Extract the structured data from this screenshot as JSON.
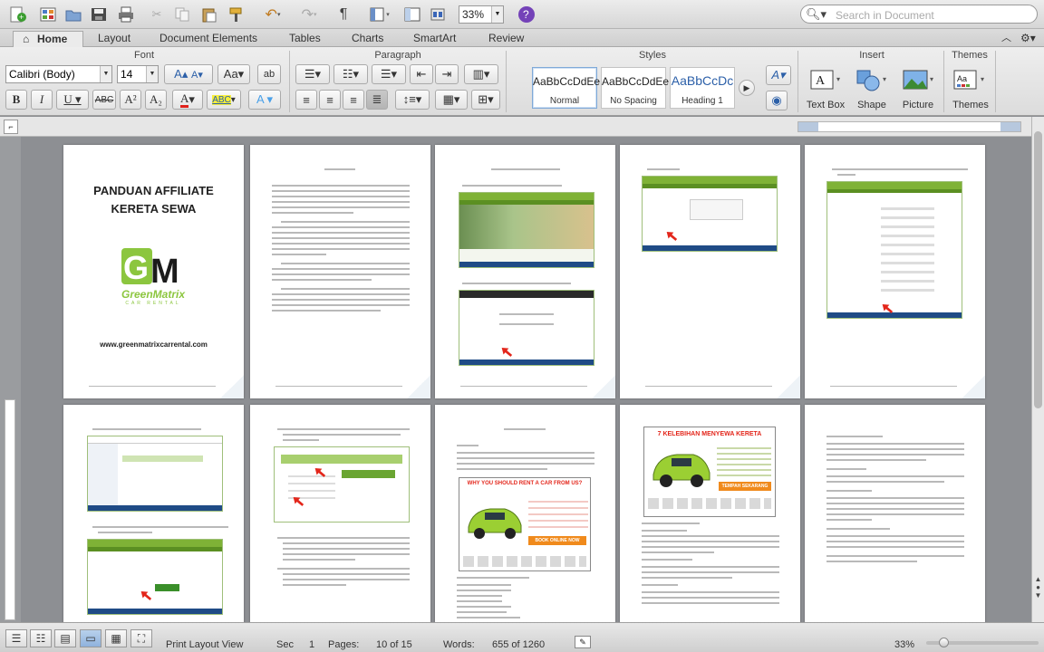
{
  "toolbar": {
    "zoom": "33%",
    "search_placeholder": "Search in Document"
  },
  "tabs": [
    {
      "label": "Home"
    },
    {
      "label": "Layout"
    },
    {
      "label": "Document Elements"
    },
    {
      "label": "Tables"
    },
    {
      "label": "Charts"
    },
    {
      "label": "SmartArt"
    },
    {
      "label": "Review"
    }
  ],
  "ribbon": {
    "groups": {
      "font": "Font",
      "paragraph": "Paragraph",
      "styles": "Styles",
      "insert": "Insert",
      "themes": "Themes"
    },
    "font_name": "Calibri (Body)",
    "font_size": "14",
    "styles": [
      {
        "preview": "AaBbCcDdEe",
        "name": "Normal"
      },
      {
        "preview": "AaBbCcDdEe",
        "name": "No Spacing"
      },
      {
        "preview": "AaBbCcDc",
        "name": "Heading 1"
      }
    ],
    "insert": {
      "textbox": "Text Box",
      "shape": "Shape",
      "picture": "Picture"
    },
    "themes_label": "Themes"
  },
  "cover": {
    "title_line1": "PANDUAN AFFILIATE",
    "title_line2": "KERETA SEWA",
    "logo_main": "GreenMatrix",
    "logo_sub": "CAR RENTAL",
    "website": "www.greenmatrixcarrental.com"
  },
  "ads": {
    "why_title": "WHY YOU SHOULD RENT A CAR FROM US?",
    "why_cta": "BOOK ONLINE NOW",
    "kelebihan_title": "7 KELEBIHAN MENYEWA KERETA",
    "kelebihan_cta": "TEMPAH SEKARANG"
  },
  "status": {
    "view": "Print Layout View",
    "sec_label": "Sec",
    "sec_value": "1",
    "pages_label": "Pages:",
    "pages_value": "10 of 15",
    "words_label": "Words:",
    "words_value": "655 of 1260",
    "zoom": "33%"
  }
}
